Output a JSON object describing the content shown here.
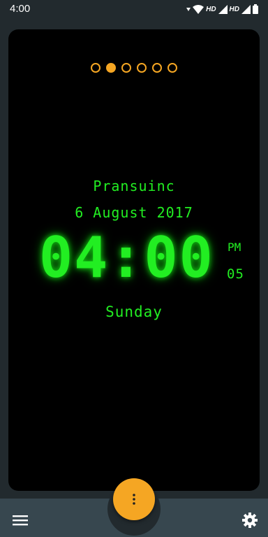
{
  "status_bar": {
    "time": "4:00",
    "network_label_1": "HD",
    "network_label_2": "HD",
    "icons": [
      "data-arrow-icon",
      "wifi-icon",
      "signal-icon",
      "signal-icon",
      "battery-icon"
    ]
  },
  "pager": {
    "page_count": 6,
    "active_page": 2
  },
  "clock": {
    "owner": "Pransuinc",
    "date": "6 August 2017",
    "time": "04:00",
    "ampm": "PM",
    "seconds": "05",
    "weekday": "Sunday"
  },
  "colors": {
    "accent": "#f5a623",
    "clock_green": "#22ee22",
    "background": "#222a2e",
    "bottom_bar": "#37474f"
  },
  "bottom_bar": {
    "left_icon": "menu-icon",
    "fab_icon": "more-vertical-icon",
    "right_icon": "gear-icon"
  }
}
